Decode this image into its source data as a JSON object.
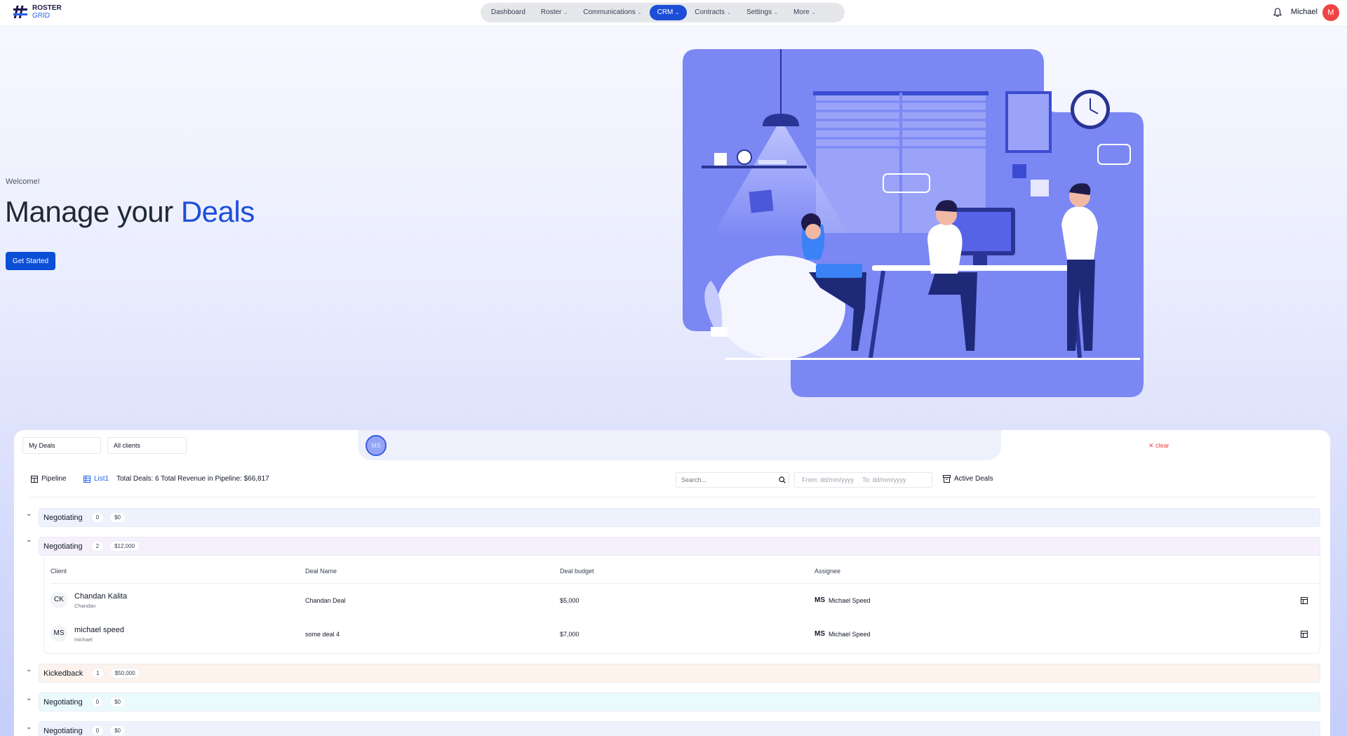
{
  "brand": {
    "line1": "ROSTER",
    "line2": "GRID"
  },
  "nav": {
    "items": [
      {
        "label": "Dashboard",
        "chevron": ""
      },
      {
        "label": "Roster",
        "chevron": "⌄"
      },
      {
        "label": "Communications",
        "chevron": "⌄"
      },
      {
        "label": "CRM",
        "chevron": "⌄"
      },
      {
        "label": "Contracts",
        "chevron": "⌄"
      },
      {
        "label": "Settings",
        "chevron": "⌄"
      },
      {
        "label": "More",
        "chevron": "⌄"
      }
    ],
    "active": "CRM"
  },
  "user": {
    "name": "Michael",
    "initial": "M"
  },
  "hero": {
    "welcome": "Welcome!",
    "title_prefix": "Manage your ",
    "title_accent": "Deals",
    "cta": "Get Started"
  },
  "filters": {
    "my_deals": "My Deals",
    "all_clients": "All clients",
    "assignee_chip": "MS",
    "clear": "clear"
  },
  "toolbar": {
    "pipeline": "Pipeline",
    "list": "List1",
    "summary": "Total Deals: 6 Total Revenue in Pipeline: $66,817",
    "search_placeholder": "Search...",
    "from": "From: dd/mm/yyyy",
    "to": "To: dd/mm/yyyy",
    "active_deals": "Active Deals"
  },
  "groups": [
    {
      "title": "Negotiating",
      "count": "0",
      "amount": "$0",
      "expanded": false,
      "color": "#eef2fd"
    },
    {
      "title": "Negotiating",
      "count": "2",
      "amount": "$12,000",
      "expanded": true,
      "color": "#f6f0fd"
    },
    {
      "title": "Kickedback",
      "count": "1",
      "amount": "$50,000",
      "expanded": false,
      "color": "#fdf3ec"
    },
    {
      "title": "Negotiating",
      "count": "0",
      "amount": "$0",
      "expanded": false,
      "color": "#ebfbfd"
    },
    {
      "title": "Negotiating",
      "count": "0",
      "amount": "$0",
      "expanded": false,
      "color": "#eef2fd"
    }
  ],
  "table": {
    "headers": {
      "client": "Client",
      "deal_name": "Deal Name",
      "budget": "Deal budget",
      "assignee": "Assignee"
    },
    "rows": [
      {
        "initials": "CK",
        "client": "Chandan Kalita",
        "sub": "Chandan",
        "deal": "Chandan Deal",
        "budget": "$5,000",
        "assignee_initials": "MS",
        "assignee": "Michael Speed"
      },
      {
        "initials": "MS",
        "client": "michael speed",
        "sub": "michael",
        "deal": "some deal 4",
        "budget": "$7,000",
        "assignee_initials": "MS",
        "assignee": "Michael Speed"
      }
    ]
  },
  "icons": {
    "logo": "hash-logo-icon",
    "bell": "bell-icon",
    "pipeline": "kanban-icon",
    "list": "list-icon",
    "search": "search-icon",
    "archive": "archive-icon",
    "clear": "close-icon",
    "row_action": "table-icon"
  },
  "colors": {
    "accent": "#1d4ed8",
    "avatar": "#ef4444",
    "clear": "#ef4444",
    "illustration": "#7b87f3"
  }
}
